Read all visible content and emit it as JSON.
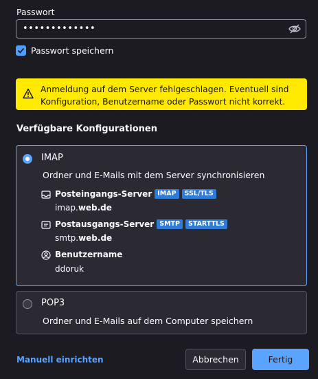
{
  "password": {
    "label": "Passwort",
    "masked_value": "•••••••••••••",
    "toggle_icon": "eye-slash-icon"
  },
  "remember": {
    "label": "Passwort speichern",
    "checked": true
  },
  "warning": {
    "text": "Anmeldung auf dem Server fehlgeschlagen. Eventuell sind Konfiguration, Benutzername oder Passwort nicht korrekt.",
    "icon": "warning-icon",
    "color": "#ffe900"
  },
  "section_title": "Verfügbare Konfigurationen",
  "imap": {
    "name": "IMAP",
    "selected": true,
    "description": "Ordner und E-Mails mit dem Server synchronisieren",
    "incoming": {
      "label": "Posteingangs-Server",
      "badges": [
        "IMAP",
        "SSL/TLS"
      ],
      "host_prefix": "imap.",
      "host_domain": "web.de"
    },
    "outgoing": {
      "label": "Postausgangs-Server",
      "badges": [
        "SMTP",
        "STARTTLS"
      ],
      "host_prefix": "smtp.",
      "host_domain": "web.de"
    },
    "user": {
      "label": "Benutzername",
      "value": "ddoruk"
    }
  },
  "pop3": {
    "name": "POP3",
    "selected": false,
    "description": "Ordner und E-Mails auf dem Computer speichern"
  },
  "footer": {
    "manual_link": "Manuell einrichten",
    "cancel_label": "Abbrechen",
    "done_label": "Fertig"
  },
  "colors": {
    "accent": "#5aa3ff",
    "background": "#1c1b22",
    "card": "#2b2a33",
    "badge": "#2e7cd6"
  }
}
